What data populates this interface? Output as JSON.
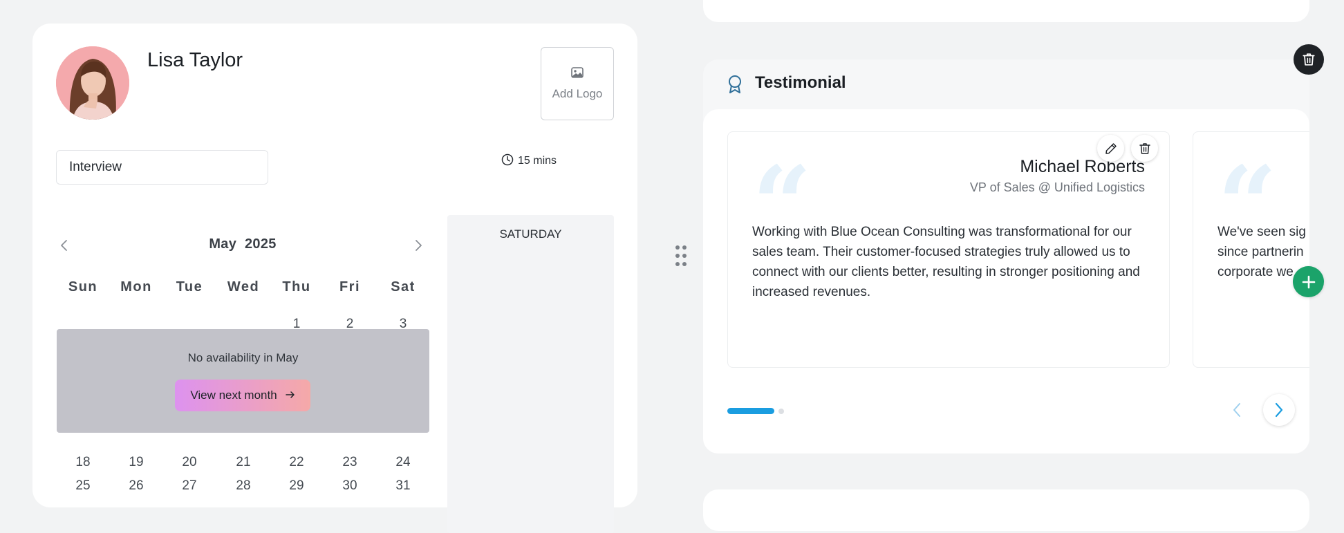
{
  "booking": {
    "host_name": "Lisa Taylor",
    "add_logo_label": "Add Logo",
    "event_type": "Interview",
    "duration": "15 mins",
    "calendar": {
      "month": "May",
      "year": "2025",
      "weekdays": [
        "Sun",
        "Mon",
        "Tue",
        "Wed",
        "Thu",
        "Fri",
        "Sat"
      ],
      "week1": [
        "1",
        "2",
        "3"
      ],
      "week4": [
        "18",
        "19",
        "20",
        "21",
        "22",
        "23",
        "24"
      ],
      "week5": [
        "25",
        "26",
        "27",
        "28",
        "29",
        "30",
        "31"
      ],
      "no_availability": "No availability in May",
      "next_month_label": "View next month"
    },
    "slots_day": "SATURDAY"
  },
  "testimonial": {
    "section_title": "Testimonial",
    "items": [
      {
        "name": "Michael Roberts",
        "role": "VP of Sales @ Unified Logistics",
        "text": "Working with Blue Ocean Consulting was transformational for our sales team. Their customer-focused strategies truly allowed us to connect with our clients better, resulting in stronger positioning and increased revenues."
      },
      {
        "text": "We've seen sig since partnerin corporate we"
      }
    ],
    "active_slide": 1,
    "slide_count": 2
  },
  "colors": {
    "accent_blue": "#1a9de0",
    "add_green": "#1ba36a",
    "unavailable_overlay": "#c2c2c9"
  },
  "icons": [
    "image-icon",
    "clock-icon",
    "chevron-left-icon",
    "chevron-right-icon",
    "drag-handle-icon",
    "award-icon",
    "pencil-icon",
    "trash-icon",
    "plus-icon",
    "quote-icon"
  ]
}
